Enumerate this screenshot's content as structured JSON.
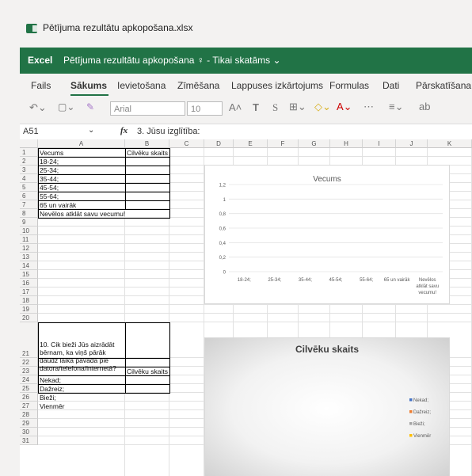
{
  "window": {
    "file_title": "Pētījuma rezultātu apkopošana.xlsx"
  },
  "appbar": {
    "app_name": "Excel",
    "doc_title": "Pētījuma rezultātu apkopošana ♀ - Tikai skatāms ⌄"
  },
  "menu": [
    "Fails",
    "Sākums",
    "Ievietošana",
    "Zīmēšana",
    "Lappuses izkārtojums",
    "Formulas",
    "Dati",
    "Pārskatīšana"
  ],
  "toolbar": {
    "font": "Arial",
    "size": "10"
  },
  "formula_bar": {
    "cell_ref": "A51",
    "fx": "fx",
    "content": "3. Jūsu izglītība:"
  },
  "columns": [
    "A",
    "B",
    "C",
    "D",
    "E",
    "F",
    "G",
    "H",
    "I",
    "J",
    "K"
  ],
  "rows": [
    "1",
    "2",
    "3",
    "4",
    "5",
    "6",
    "7",
    "8",
    "9",
    "10",
    "11",
    "12",
    "13",
    "14",
    "15",
    "16",
    "17",
    "18",
    "19",
    "20",
    "21",
    "22",
    "23",
    "24",
    "25",
    "26",
    "27",
    "28",
    "29",
    "30",
    "31"
  ],
  "table1": {
    "header_a": "Vecums",
    "header_b": "Cilvēku skaits",
    "items": [
      "18-24;",
      "25-34;",
      "35-44;",
      "45-54;",
      "55-64;",
      "65 un vairāk",
      "Nevēlos atklāt savu vecumu!"
    ]
  },
  "table2": {
    "question": "10. Cik bieži Jūs aizrādāt bērnam, ka viņš pārāk daudz laika pavada pie datora/telefona/internetā?",
    "header_b": "Cilvēku skaits",
    "items": [
      "Nekad;",
      "Dažreiz;",
      "Bieži;",
      "Vienmēr"
    ]
  },
  "chart_data": [
    {
      "type": "bar",
      "title": "Vecums",
      "categories": [
        "18-24;",
        "25-34;",
        "35-44;",
        "45-54;",
        "55-64;",
        "65 un vairāk",
        "Nevēlos atklāt savu vecumu!"
      ],
      "values": [
        0,
        0,
        0,
        0,
        0,
        0,
        0
      ],
      "ylim": [
        0,
        1.2
      ],
      "yticks": [
        "0",
        "0,2",
        "0,4",
        "0,6",
        "0,8",
        "1",
        "1,2"
      ],
      "grid": true
    },
    {
      "type": "pie",
      "title": "Cilvēku skaits",
      "categories": [
        "Nekad;",
        "Dažreiz;",
        "Bieži;",
        "Vienmēr"
      ],
      "values": [
        0,
        0,
        0,
        0
      ],
      "legend_placement": "right",
      "colors": [
        "#4472c4",
        "#ed7d31",
        "#a5a5a5",
        "#ffc000"
      ]
    }
  ]
}
